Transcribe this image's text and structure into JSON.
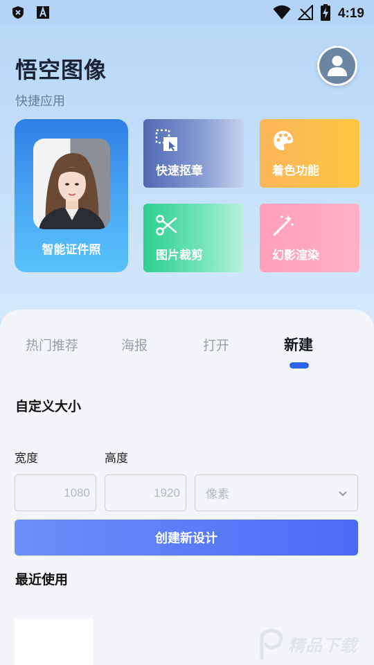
{
  "status_bar": {
    "time": "4:19",
    "icons": [
      "shield-x-icon",
      "font-a-icon",
      "wifi-icon",
      "no-signal-icon",
      "battery-charging-icon"
    ]
  },
  "header": {
    "app_title": "悟空图像",
    "subtitle": "快捷应用",
    "avatar_icon": "user-avatar-icon"
  },
  "features": {
    "id_photo": {
      "label": "智能证件照",
      "icon": "portrait-photo"
    },
    "cutout": {
      "label": "快速抠章",
      "icon": "selection-cursor-icon"
    },
    "coloring": {
      "label": "着色功能",
      "icon": "palette-icon"
    },
    "crop": {
      "label": "图片裁剪",
      "icon": "scissors-icon"
    },
    "render": {
      "label": "幻影渲染",
      "icon": "magic-wand-icon"
    }
  },
  "tabs": [
    {
      "label": "热门推荐",
      "active": false
    },
    {
      "label": "海报",
      "active": false
    },
    {
      "label": "打开",
      "active": false
    },
    {
      "label": "新建",
      "active": true
    }
  ],
  "custom_size": {
    "title": "自定义大小",
    "width_label": "宽度",
    "height_label": "高度",
    "width_placeholder": "1080",
    "height_placeholder": "1920",
    "unit_selected": "像素",
    "create_button": "创建新设计"
  },
  "recent": {
    "title": "最近使用"
  },
  "colors": {
    "accent": "#4a6cf5",
    "tab_indicator": "#2f66e8",
    "title": "#1a2233"
  }
}
